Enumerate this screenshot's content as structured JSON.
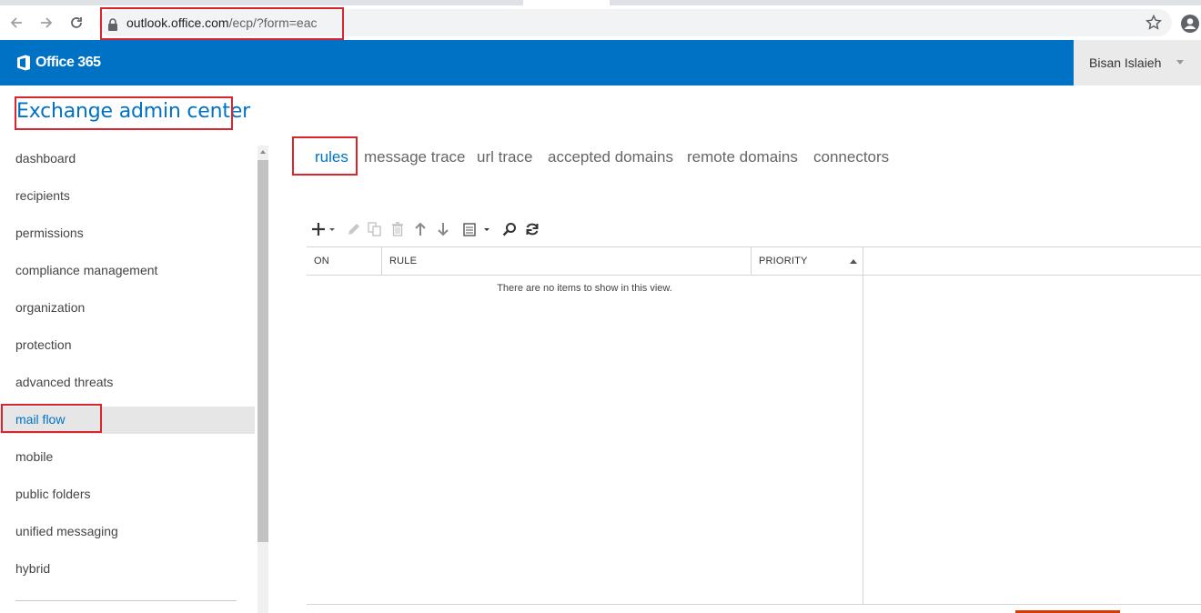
{
  "browser": {
    "url_host": "outlook.office.com",
    "url_path": "/ecp/?form=eac"
  },
  "header": {
    "brand": "Office 365",
    "user_name": "Bisan Islaieh",
    "accent": "#0072c6"
  },
  "app": {
    "title": "Exchange admin center"
  },
  "sidebar": {
    "selected": "mail flow",
    "items": [
      {
        "label": "dashboard"
      },
      {
        "label": "recipients"
      },
      {
        "label": "permissions"
      },
      {
        "label": "compliance management"
      },
      {
        "label": "organization"
      },
      {
        "label": "protection"
      },
      {
        "label": "advanced threats"
      },
      {
        "label": "mail flow"
      },
      {
        "label": "mobile"
      },
      {
        "label": "public folders"
      },
      {
        "label": "unified messaging"
      },
      {
        "label": "hybrid"
      }
    ]
  },
  "tabs": {
    "selected": "rules",
    "items": [
      {
        "label": "rules"
      },
      {
        "label": "message trace"
      },
      {
        "label": "url trace"
      },
      {
        "label": "accepted domains"
      },
      {
        "label": "remote domains"
      },
      {
        "label": "connectors"
      }
    ]
  },
  "toolbar": {
    "icons": [
      "add-icon",
      "edit-icon",
      "copy-icon",
      "delete-icon",
      "move-up-icon",
      "move-down-icon",
      "report-icon",
      "search-icon",
      "refresh-icon"
    ]
  },
  "grid": {
    "columns": [
      {
        "label": "ON"
      },
      {
        "label": "RULE"
      },
      {
        "label": "PRIORITY"
      }
    ],
    "sort": "PRIORITY ascending",
    "empty_message": "There are no items to show in this view."
  },
  "annotation_color": "#d9262e"
}
